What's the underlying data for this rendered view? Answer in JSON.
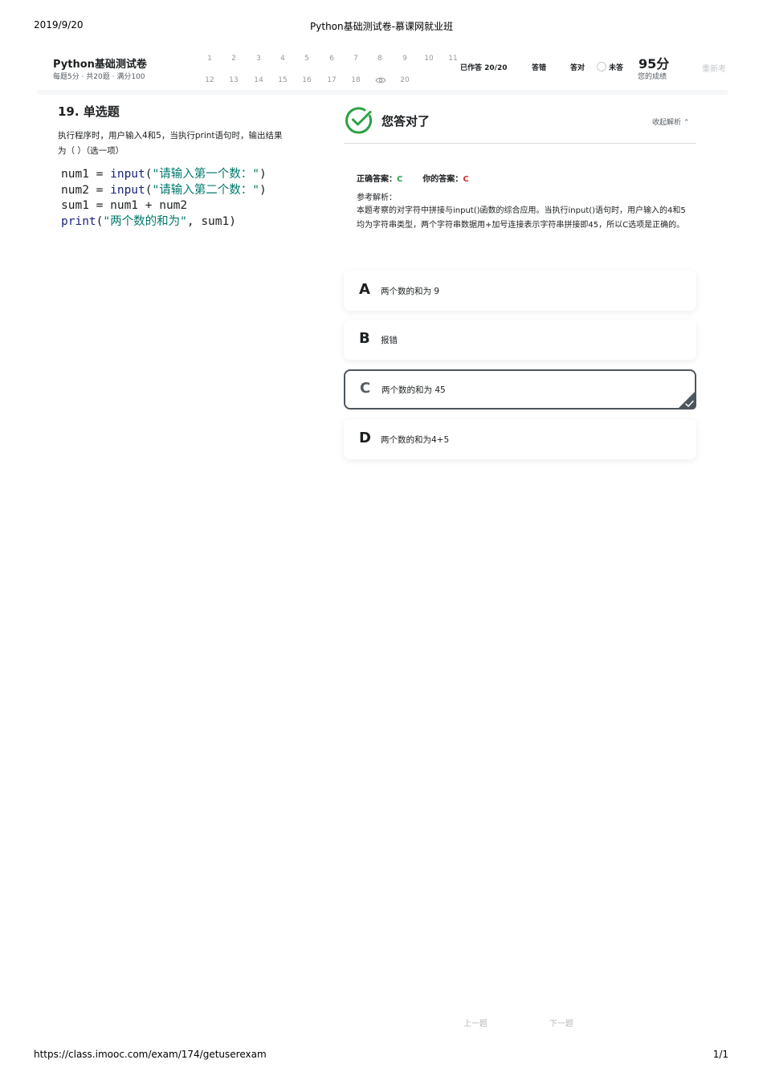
{
  "print": {
    "date": "2019/9/20",
    "title": "Python基础测试卷-慕课网就业班",
    "url": "https://class.imooc.com/exam/174/getuserexam",
    "page": "1/1"
  },
  "header": {
    "exam_title": "Python基础测试卷",
    "meta": "每题5分 · 共20题 · 满分100",
    "question_nav_row1": [
      "1",
      "2",
      "3",
      "4",
      "5",
      "6",
      "7",
      "8",
      "9",
      "10",
      "11"
    ],
    "question_nav_row2": [
      "12",
      "13",
      "14",
      "15",
      "16",
      "17",
      "18",
      "",
      "20"
    ],
    "current_question_icon": "eye-icon",
    "stats": {
      "done": "已作答 20/20",
      "wrong": "答错",
      "right": "答对",
      "unanswered": "未答"
    },
    "score": "95分",
    "score_label": "您的成绩",
    "retake": "重新考"
  },
  "question": {
    "title": "19. 单选题",
    "text": "执行程序时，用户输入4和5，当执行print语句时，输出结果为（ ）（选一项）",
    "code": {
      "line1": {
        "var": "num1 = ",
        "fn": "input",
        "open": "(",
        "str": "\"请输入第一个数：\"",
        "close": ")"
      },
      "line2": {
        "var": "num2 = ",
        "fn": "input",
        "open": "(",
        "str": "\"请输入第二个数：\"",
        "close": ")"
      },
      "line3": "sum1 = num1 + num2",
      "line4": {
        "fn": "print",
        "open": "(",
        "str": "\"两个数的和为\"",
        "rest": ", sum1)"
      }
    }
  },
  "result": {
    "text": "您答对了",
    "collapse": "收起解析 ⌃",
    "correct_label": "正确答案：",
    "correct_value": "C",
    "yours_label": "你的答案：",
    "yours_value": "C",
    "analysis_label": "参考解析：",
    "analysis": "本题考察的对字符中拼接与input()函数的综合应用。当执行input()语句时，用户输入的4和5均为字符串类型，两个字符串数据用+加号连接表示字符串拼接即45，所以C选项是正确的。"
  },
  "options": [
    {
      "letter": "A",
      "text": "两个数的和为 9"
    },
    {
      "letter": "B",
      "text": "报错"
    },
    {
      "letter": "C",
      "text": "两个数的和为 45"
    },
    {
      "letter": "D",
      "text": "两个数的和为4+5"
    }
  ],
  "nav": {
    "prev": "上一题",
    "next": "下一题"
  },
  "colors": {
    "correct": "#2ba245",
    "wrong": "#d32f2f",
    "selected_border": "#4d555d"
  }
}
